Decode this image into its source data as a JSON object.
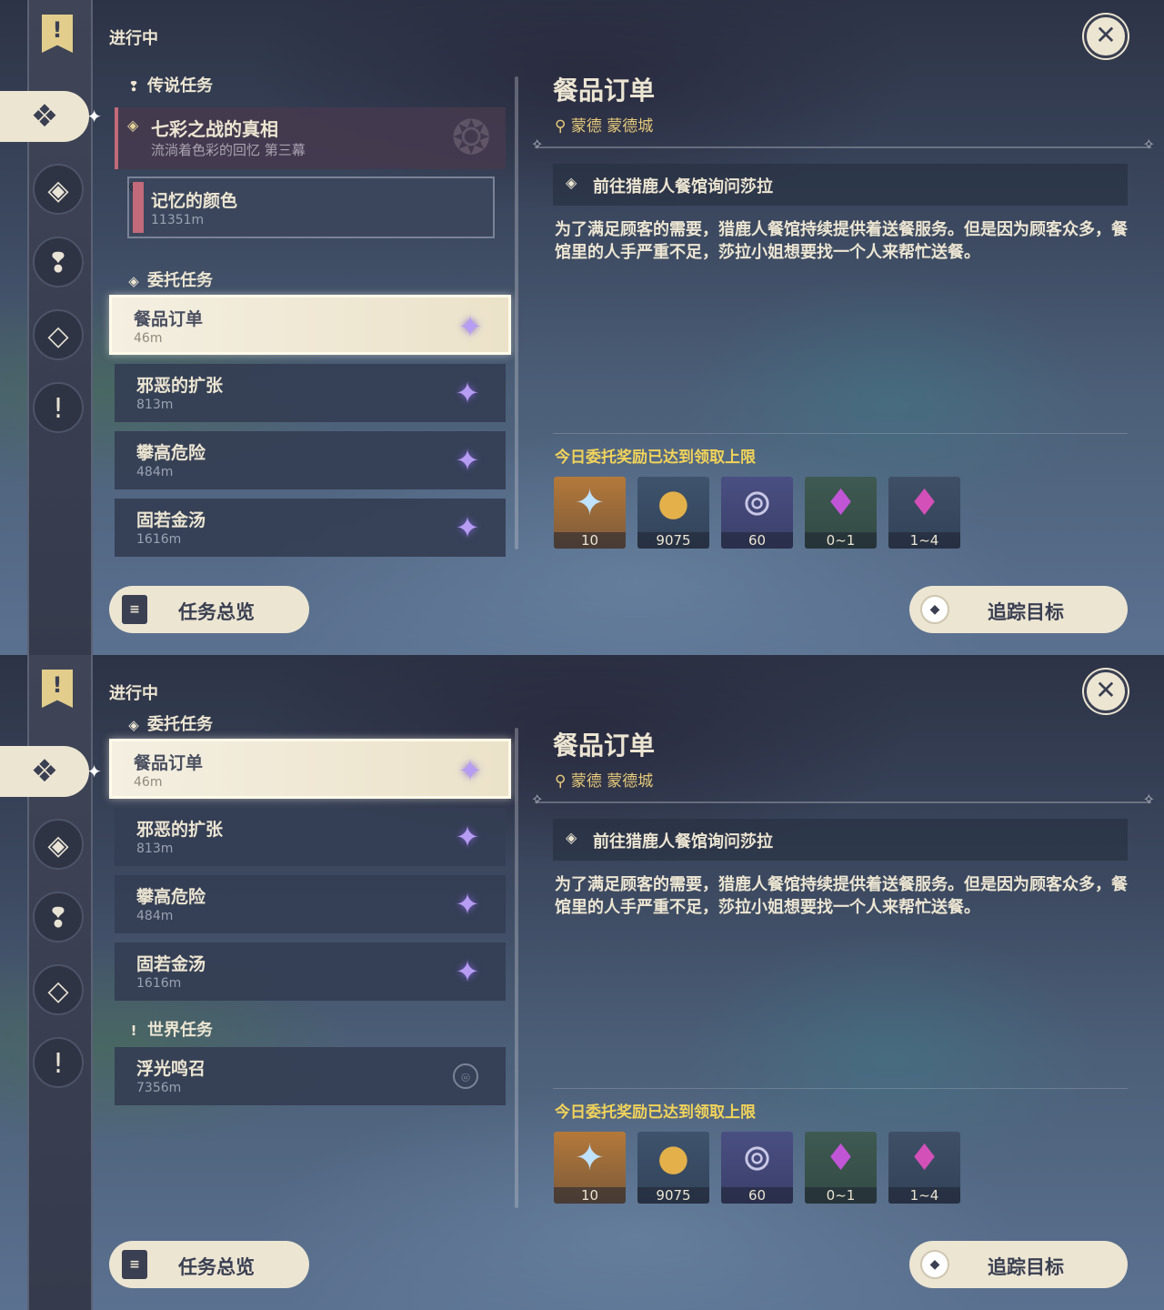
{
  "panels": [
    {
      "status_label": "进行中",
      "legend_section": {
        "title": "传说任务",
        "quest": {
          "name": "七彩之战的真相",
          "subtitle": "流淌着色彩的回忆  第三幕"
        },
        "subquest": {
          "name": "记忆的颜色",
          "distance": "11351m"
        }
      },
      "commission_section": {
        "title": "委托任务",
        "quests": [
          {
            "name": "餐品订单",
            "distance": "46m",
            "selected": true
          },
          {
            "name": "邪恶的扩张",
            "distance": "813m"
          },
          {
            "name": "攀高危险",
            "distance": "484m"
          },
          {
            "name": "固若金汤",
            "distance": "1616m"
          }
        ]
      }
    },
    {
      "status_label": "进行中",
      "commission_section": {
        "title": "委托任务",
        "quests": [
          {
            "name": "餐品订单",
            "distance": "46m",
            "selected": true
          },
          {
            "name": "邪恶的扩张",
            "distance": "813m"
          },
          {
            "name": "攀高危险",
            "distance": "484m"
          },
          {
            "name": "固若金汤",
            "distance": "1616m"
          }
        ]
      },
      "world_section": {
        "title": "世界任务",
        "quests": [
          {
            "name": "浮光鸣召",
            "distance": "7356m"
          }
        ]
      }
    }
  ],
  "detail": {
    "title": "餐品订单",
    "location": "蒙德 蒙德城",
    "objective": "前往猎鹿人餐馆询问莎拉",
    "description": "为了满足顾客的需要，猎鹿人餐馆持续提供着送餐服务。但是因为顾客众多，餐馆里的人手严重不足，莎拉小姐想要找一个人来帮忙送餐。",
    "reward_note": "今日委托奖励已达到领取上限",
    "rewards": [
      {
        "icon": "primogem-icon",
        "count": "10"
      },
      {
        "icon": "mora-icon",
        "count": "9075"
      },
      {
        "icon": "adventure-exp-icon",
        "count": "60"
      },
      {
        "icon": "crystal-icon",
        "count": "0~1"
      },
      {
        "icon": "crystal-cluster-icon",
        "count": "1~4"
      }
    ]
  },
  "buttons": {
    "overview": "任务总览",
    "track": "追踪目标"
  },
  "colors": {
    "accent_gold": "#f2d35a",
    "cream": "#ece5d2",
    "legend_red": "#c26a7a",
    "commission_purple": "#b69cf2"
  }
}
